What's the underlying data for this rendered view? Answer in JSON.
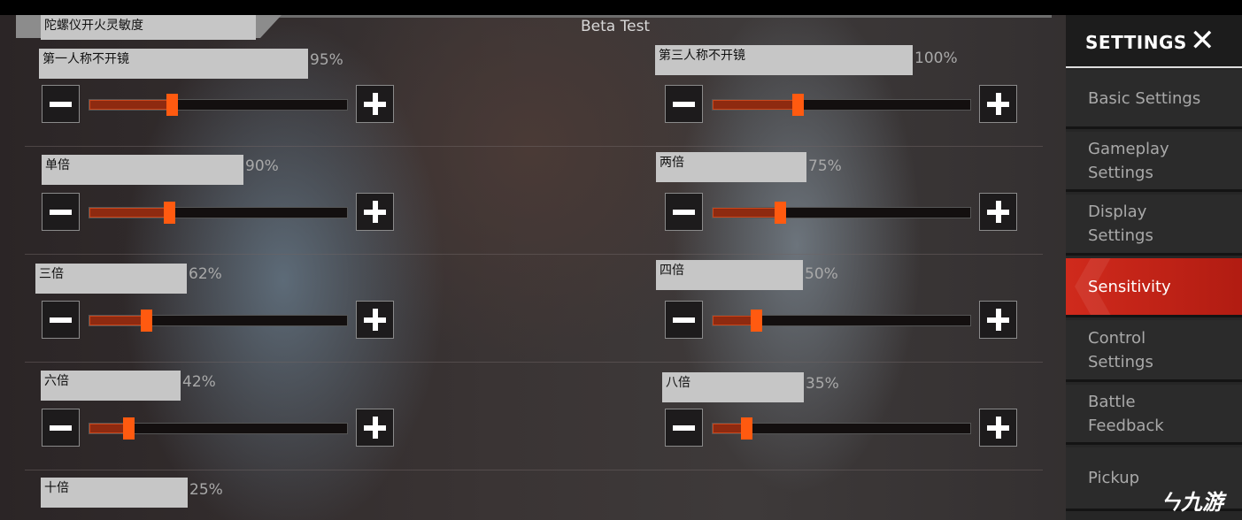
{
  "header": {
    "title": "陀螺仪开火灵敏度",
    "center": "Beta Test"
  },
  "sliders": [
    {
      "label": "第一人称不开镜",
      "value": "95%",
      "fill": 0.32
    },
    {
      "label": "第三人称不开镜",
      "value": "100%",
      "fill": 0.33
    },
    {
      "label": "单倍",
      "value": "90%",
      "fill": 0.31
    },
    {
      "label": "两倍",
      "value": "75%",
      "fill": 0.26
    },
    {
      "label": "三倍",
      "value": "62%",
      "fill": 0.22
    },
    {
      "label": "四倍",
      "value": "50%",
      "fill": 0.17
    },
    {
      "label": "六倍",
      "value": "42%",
      "fill": 0.15
    },
    {
      "label": "八倍",
      "value": "35%",
      "fill": 0.13
    },
    {
      "label": "十倍",
      "value": "25%"
    }
  ],
  "sidebar": {
    "title": "SETTINGS",
    "close_icon": "close-x-icon",
    "items": [
      {
        "label": "Basic Settings"
      },
      {
        "label": "Gameplay Settings"
      },
      {
        "label": "Display Settings"
      },
      {
        "label": "Sensitivity",
        "active": true
      },
      {
        "label": "Control Settings"
      },
      {
        "label": "Battle Feedback"
      },
      {
        "label": "Pickup"
      }
    ]
  },
  "watermark": "九游",
  "colors": {
    "accent": "#ff5a10",
    "active_tab": "#c8241a"
  }
}
